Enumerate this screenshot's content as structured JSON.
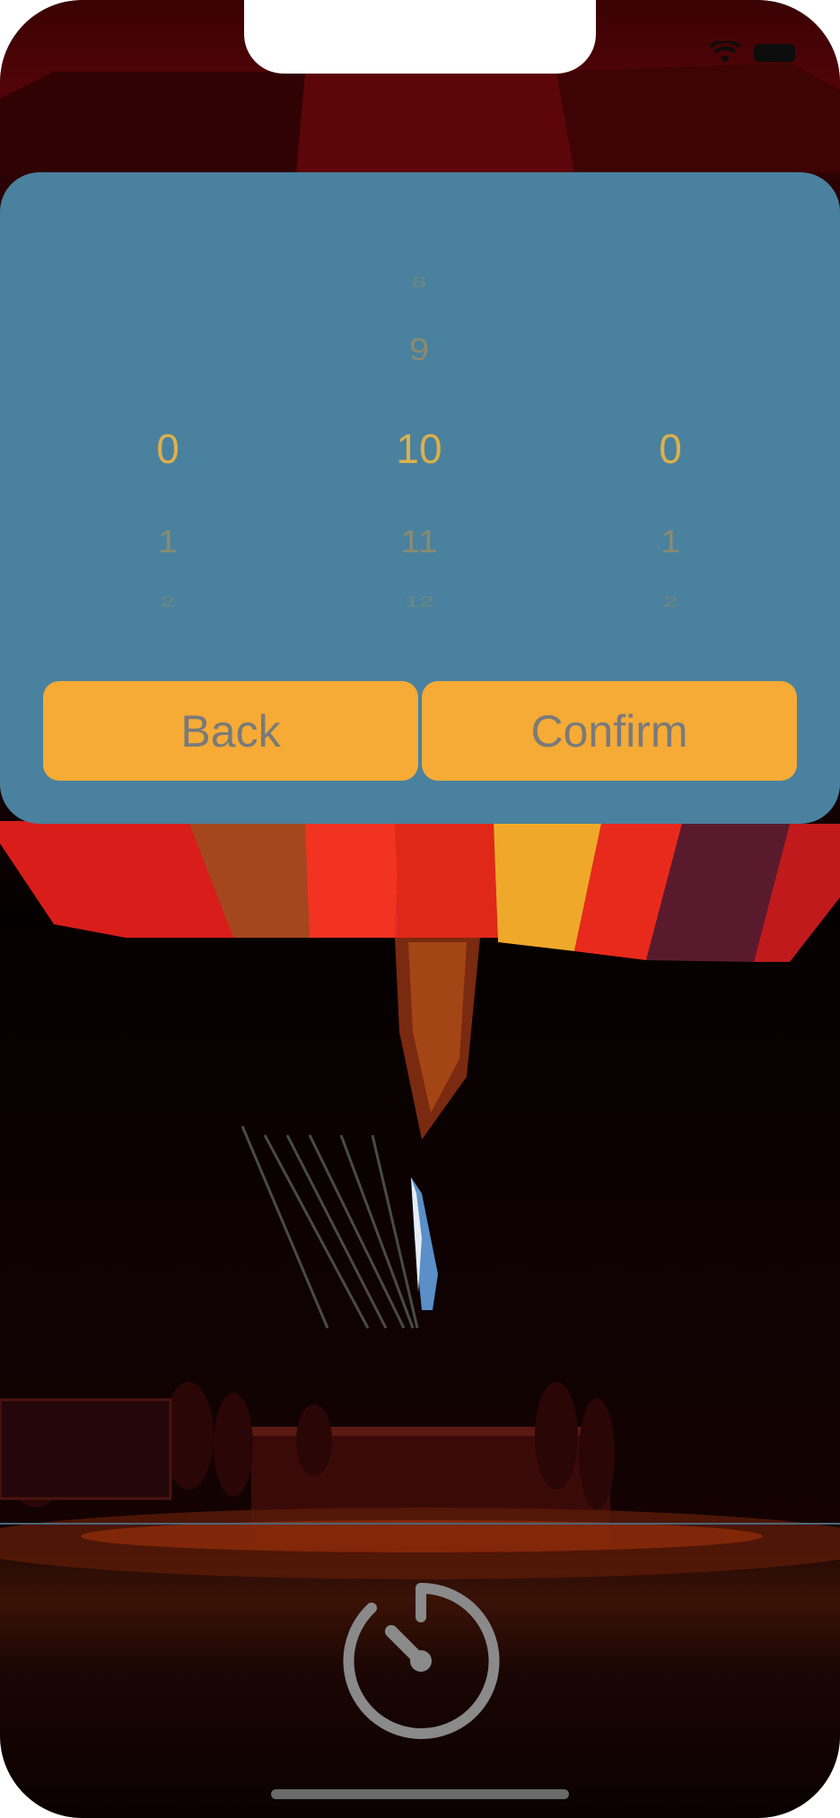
{
  "status_bar": {
    "wifi_icon": "wifi-icon",
    "battery_icon": "battery-icon"
  },
  "picker": {
    "columns": [
      {
        "name": "left",
        "above_far": "",
        "above_near": "",
        "selected": "0",
        "below_near": "1",
        "below_far": "2"
      },
      {
        "name": "middle",
        "above_far": "8",
        "above_near": "9",
        "selected": "10",
        "below_near": "11",
        "below_far": "12"
      },
      {
        "name": "right",
        "above_far": "",
        "above_near": "",
        "selected": "0",
        "below_near": "1",
        "below_far": "2"
      }
    ]
  },
  "buttons": {
    "back_label": "Back",
    "confirm_label": "Confirm"
  },
  "timer": {
    "icon": "stopwatch-icon"
  },
  "colors": {
    "panel": "#4a819e",
    "button": "#f5ab36",
    "button_text": "#7a7a7a",
    "picker_selected": "#dcb04a",
    "timer_icon": "#8a8a8a"
  }
}
